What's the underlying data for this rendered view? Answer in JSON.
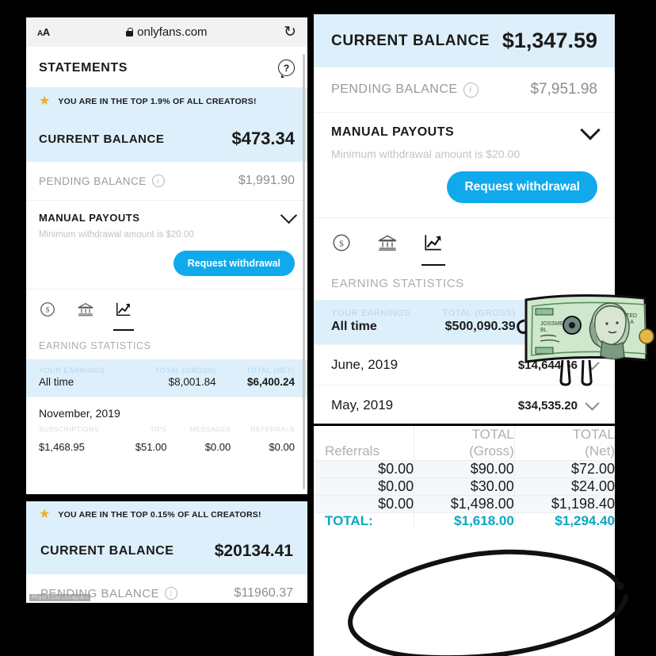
{
  "panel_top_left": {
    "browser": {
      "text_size_button": "AA",
      "url": "onlyfans.com",
      "lock_icon": "lock-icon",
      "reload_icon": "reload-icon",
      "reload_glyph": "↻"
    },
    "page_title": "STATEMENTS",
    "help_icon": "question-mark-icon",
    "banner": {
      "star_icon": "star-icon",
      "star_glyph": "★",
      "text": "YOU ARE IN THE TOP 1.9% OF ALL CREATORS!"
    },
    "current_balance": {
      "label": "CURRENT BALANCE",
      "value": "$473.34"
    },
    "pending_balance": {
      "label": "PENDING BALANCE",
      "value": "$1,991.90",
      "info_icon": "info-icon",
      "info_glyph": "i"
    },
    "manual_payouts": {
      "title": "MANUAL PAYOUTS",
      "chevron_icon": "chevron-down-icon",
      "minimum_note": "Minimum withdrawal amount is $20.00",
      "button_label": "Request withdrawal"
    },
    "tabs": [
      {
        "icon": "dollar-circle-icon",
        "active": false
      },
      {
        "icon": "bank-icon",
        "active": false
      },
      {
        "icon": "chart-trending-up-icon",
        "active": true
      }
    ],
    "earning_statistics": {
      "section_title": "EARNING STATISTICS",
      "headers": [
        "YOUR EARNINGS",
        "TOTAL (GROSS)",
        "TOTAL (NET)"
      ],
      "all_time_row": [
        "All time",
        "$8,001.84",
        "$6,400.24"
      ],
      "month": {
        "name": "November, 2019",
        "headers": [
          "SUBSCRIPTIONS",
          "TIPS",
          "MESSAGES",
          "REFERRALS"
        ],
        "values": [
          "$1,468.95",
          "$51.00",
          "$0.00",
          "$0.00"
        ]
      }
    }
  },
  "panel_top_right": {
    "current_balance": {
      "label": "CURRENT BALANCE",
      "value": "$1,347.59"
    },
    "pending_balance": {
      "label": "PENDING BALANCE",
      "value": "$7,951.98",
      "info_icon": "info-icon",
      "info_glyph": "i"
    },
    "manual_payouts": {
      "title": "MANUAL PAYOUTS",
      "chevron_icon": "chevron-down-icon",
      "minimum_note": "Minimum withdrawal amount is $20.00",
      "button_label": "Request withdrawal"
    },
    "tabs": [
      {
        "icon": "dollar-circle-icon",
        "active": false
      },
      {
        "icon": "bank-icon",
        "active": false
      },
      {
        "icon": "chart-trending-up-icon",
        "active": true
      }
    ],
    "earning_statistics": {
      "section_title": "EARNING STATISTICS",
      "headers": [
        "YOUR EARNINGS",
        "TOTAL (GROSS)"
      ],
      "all_time_row": [
        "All time",
        "$500,090.39"
      ],
      "months": [
        {
          "name": "June, 2019",
          "value": "$14,644.66",
          "chevron_icon": "chevron-down-icon"
        },
        {
          "name": "May, 2019",
          "value": "$34,535.20",
          "chevron_icon": "chevron-down-icon"
        }
      ]
    },
    "sticker": {
      "name": "cartoon-dollar-bill-sticker",
      "denomination": "100"
    }
  },
  "panel_bottom_left": {
    "banner": {
      "star_icon": "star-icon",
      "star_glyph": "★",
      "text": "YOU ARE IN THE TOP 0.15% OF ALL CREATORS!"
    },
    "current_balance": {
      "label": "CURRENT BALANCE",
      "value": "$20134.41"
    },
    "pending_balance": {
      "label": "PENDING BALANCE",
      "value": "$11960.37",
      "info_icon": "info-icon",
      "info_glyph": "i"
    },
    "watermark": "Physi Flow Instagram"
  },
  "panel_bottom_right": {
    "headers": [
      "Referrals",
      "TOTAL\n(Gross)",
      "TOTAL\n(Net)"
    ],
    "header_lines": [
      [
        "Referrals",
        ""
      ],
      [
        "TOTAL",
        "(Gross)"
      ],
      [
        "TOTAL",
        "(Net)"
      ]
    ],
    "rows": [
      [
        "$0.00",
        "$90.00",
        "$72.00"
      ],
      [
        "$0.00",
        "$30.00",
        "$24.00"
      ],
      [
        "$0.00",
        "$1,498.00",
        "$1,198.40"
      ]
    ],
    "total_row": [
      "TOTAL:",
      "$1,618.00",
      "$1,294.40"
    ],
    "annotation": "hand-drawn-circle-highlight",
    "total_color": "#07a8c4"
  },
  "colors": {
    "background": "#000000",
    "accent_blue": "#10a9ec",
    "banner_blue": "#ddeffb",
    "teal_total": "#07a8c4",
    "star_gold": "#f0ad20",
    "muted_gray": "#9a9a9a"
  }
}
